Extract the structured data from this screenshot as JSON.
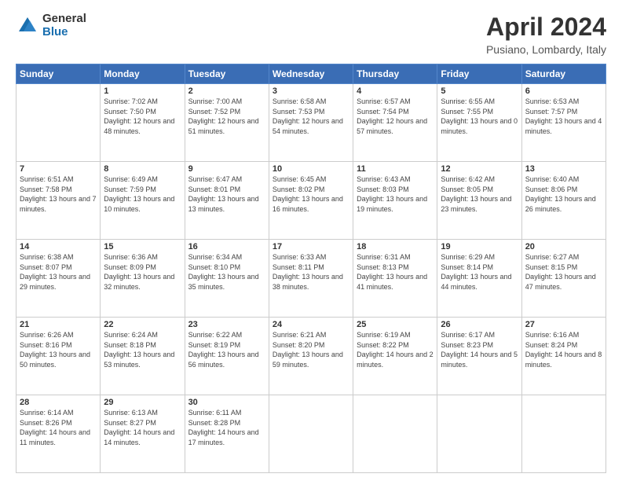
{
  "logo": {
    "general": "General",
    "blue": "Blue"
  },
  "title": "April 2024",
  "subtitle": "Pusiano, Lombardy, Italy",
  "weekdays": [
    "Sunday",
    "Monday",
    "Tuesday",
    "Wednesday",
    "Thursday",
    "Friday",
    "Saturday"
  ],
  "weeks": [
    [
      {
        "day": "",
        "sunrise": "",
        "sunset": "",
        "daylight": ""
      },
      {
        "day": "1",
        "sunrise": "Sunrise: 7:02 AM",
        "sunset": "Sunset: 7:50 PM",
        "daylight": "Daylight: 12 hours and 48 minutes."
      },
      {
        "day": "2",
        "sunrise": "Sunrise: 7:00 AM",
        "sunset": "Sunset: 7:52 PM",
        "daylight": "Daylight: 12 hours and 51 minutes."
      },
      {
        "day": "3",
        "sunrise": "Sunrise: 6:58 AM",
        "sunset": "Sunset: 7:53 PM",
        "daylight": "Daylight: 12 hours and 54 minutes."
      },
      {
        "day": "4",
        "sunrise": "Sunrise: 6:57 AM",
        "sunset": "Sunset: 7:54 PM",
        "daylight": "Daylight: 12 hours and 57 minutes."
      },
      {
        "day": "5",
        "sunrise": "Sunrise: 6:55 AM",
        "sunset": "Sunset: 7:55 PM",
        "daylight": "Daylight: 13 hours and 0 minutes."
      },
      {
        "day": "6",
        "sunrise": "Sunrise: 6:53 AM",
        "sunset": "Sunset: 7:57 PM",
        "daylight": "Daylight: 13 hours and 4 minutes."
      }
    ],
    [
      {
        "day": "7",
        "sunrise": "Sunrise: 6:51 AM",
        "sunset": "Sunset: 7:58 PM",
        "daylight": "Daylight: 13 hours and 7 minutes."
      },
      {
        "day": "8",
        "sunrise": "Sunrise: 6:49 AM",
        "sunset": "Sunset: 7:59 PM",
        "daylight": "Daylight: 13 hours and 10 minutes."
      },
      {
        "day": "9",
        "sunrise": "Sunrise: 6:47 AM",
        "sunset": "Sunset: 8:01 PM",
        "daylight": "Daylight: 13 hours and 13 minutes."
      },
      {
        "day": "10",
        "sunrise": "Sunrise: 6:45 AM",
        "sunset": "Sunset: 8:02 PM",
        "daylight": "Daylight: 13 hours and 16 minutes."
      },
      {
        "day": "11",
        "sunrise": "Sunrise: 6:43 AM",
        "sunset": "Sunset: 8:03 PM",
        "daylight": "Daylight: 13 hours and 19 minutes."
      },
      {
        "day": "12",
        "sunrise": "Sunrise: 6:42 AM",
        "sunset": "Sunset: 8:05 PM",
        "daylight": "Daylight: 13 hours and 23 minutes."
      },
      {
        "day": "13",
        "sunrise": "Sunrise: 6:40 AM",
        "sunset": "Sunset: 8:06 PM",
        "daylight": "Daylight: 13 hours and 26 minutes."
      }
    ],
    [
      {
        "day": "14",
        "sunrise": "Sunrise: 6:38 AM",
        "sunset": "Sunset: 8:07 PM",
        "daylight": "Daylight: 13 hours and 29 minutes."
      },
      {
        "day": "15",
        "sunrise": "Sunrise: 6:36 AM",
        "sunset": "Sunset: 8:09 PM",
        "daylight": "Daylight: 13 hours and 32 minutes."
      },
      {
        "day": "16",
        "sunrise": "Sunrise: 6:34 AM",
        "sunset": "Sunset: 8:10 PM",
        "daylight": "Daylight: 13 hours and 35 minutes."
      },
      {
        "day": "17",
        "sunrise": "Sunrise: 6:33 AM",
        "sunset": "Sunset: 8:11 PM",
        "daylight": "Daylight: 13 hours and 38 minutes."
      },
      {
        "day": "18",
        "sunrise": "Sunrise: 6:31 AM",
        "sunset": "Sunset: 8:13 PM",
        "daylight": "Daylight: 13 hours and 41 minutes."
      },
      {
        "day": "19",
        "sunrise": "Sunrise: 6:29 AM",
        "sunset": "Sunset: 8:14 PM",
        "daylight": "Daylight: 13 hours and 44 minutes."
      },
      {
        "day": "20",
        "sunrise": "Sunrise: 6:27 AM",
        "sunset": "Sunset: 8:15 PM",
        "daylight": "Daylight: 13 hours and 47 minutes."
      }
    ],
    [
      {
        "day": "21",
        "sunrise": "Sunrise: 6:26 AM",
        "sunset": "Sunset: 8:16 PM",
        "daylight": "Daylight: 13 hours and 50 minutes."
      },
      {
        "day": "22",
        "sunrise": "Sunrise: 6:24 AM",
        "sunset": "Sunset: 8:18 PM",
        "daylight": "Daylight: 13 hours and 53 minutes."
      },
      {
        "day": "23",
        "sunrise": "Sunrise: 6:22 AM",
        "sunset": "Sunset: 8:19 PM",
        "daylight": "Daylight: 13 hours and 56 minutes."
      },
      {
        "day": "24",
        "sunrise": "Sunrise: 6:21 AM",
        "sunset": "Sunset: 8:20 PM",
        "daylight": "Daylight: 13 hours and 59 minutes."
      },
      {
        "day": "25",
        "sunrise": "Sunrise: 6:19 AM",
        "sunset": "Sunset: 8:22 PM",
        "daylight": "Daylight: 14 hours and 2 minutes."
      },
      {
        "day": "26",
        "sunrise": "Sunrise: 6:17 AM",
        "sunset": "Sunset: 8:23 PM",
        "daylight": "Daylight: 14 hours and 5 minutes."
      },
      {
        "day": "27",
        "sunrise": "Sunrise: 6:16 AM",
        "sunset": "Sunset: 8:24 PM",
        "daylight": "Daylight: 14 hours and 8 minutes."
      }
    ],
    [
      {
        "day": "28",
        "sunrise": "Sunrise: 6:14 AM",
        "sunset": "Sunset: 8:26 PM",
        "daylight": "Daylight: 14 hours and 11 minutes."
      },
      {
        "day": "29",
        "sunrise": "Sunrise: 6:13 AM",
        "sunset": "Sunset: 8:27 PM",
        "daylight": "Daylight: 14 hours and 14 minutes."
      },
      {
        "day": "30",
        "sunrise": "Sunrise: 6:11 AM",
        "sunset": "Sunset: 8:28 PM",
        "daylight": "Daylight: 14 hours and 17 minutes."
      },
      {
        "day": "",
        "sunrise": "",
        "sunset": "",
        "daylight": ""
      },
      {
        "day": "",
        "sunrise": "",
        "sunset": "",
        "daylight": ""
      },
      {
        "day": "",
        "sunrise": "",
        "sunset": "",
        "daylight": ""
      },
      {
        "day": "",
        "sunrise": "",
        "sunset": "",
        "daylight": ""
      }
    ]
  ]
}
